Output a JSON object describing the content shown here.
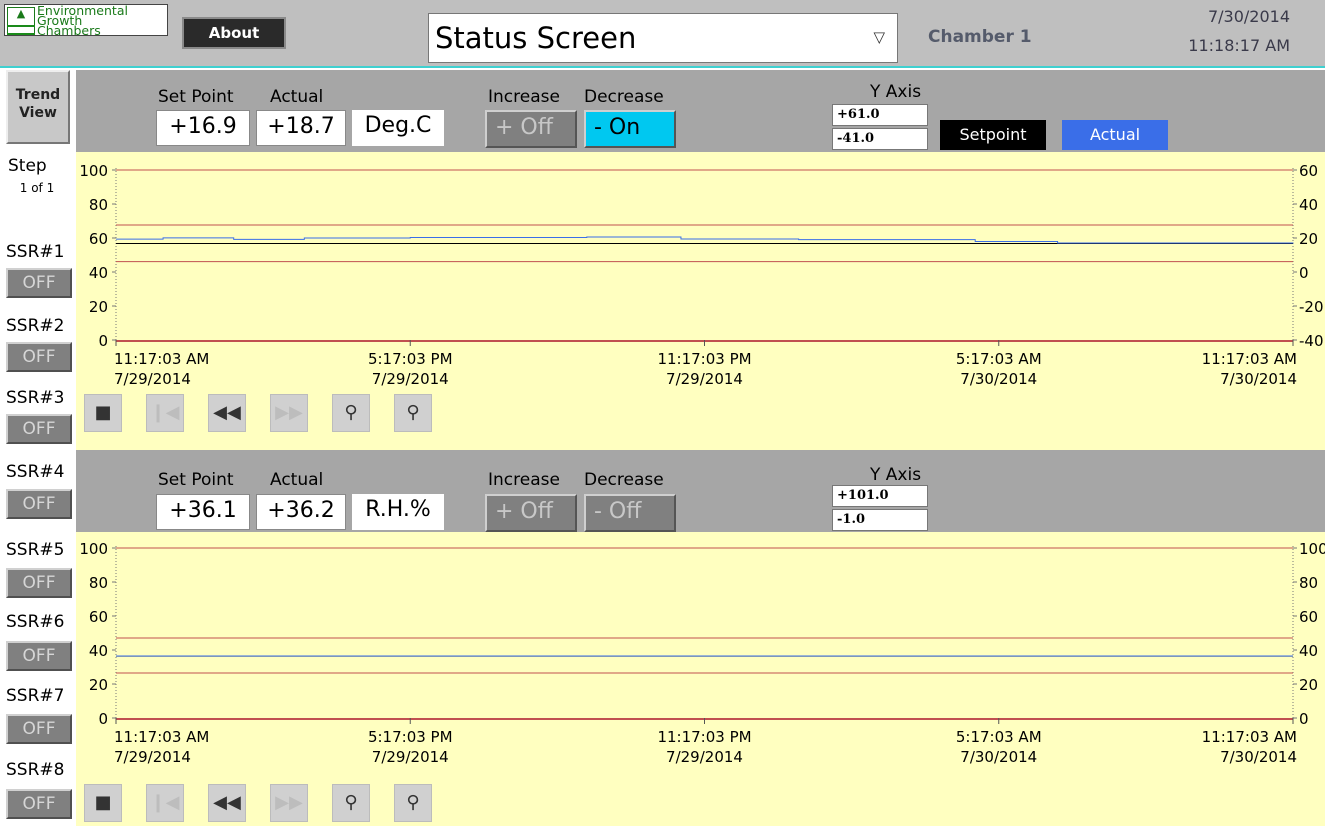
{
  "header": {
    "logo_lines": [
      "Environmental",
      "Growth",
      "Chambers"
    ],
    "about_label": "About",
    "screen_select": "Status Screen",
    "chamber": "Chamber 1",
    "date": "7/30/2014",
    "time": "11:18:17 AM"
  },
  "sidebar": {
    "trend_view_label": "Trend View",
    "step_label": "Step",
    "step_value": "1 of 1",
    "ssr": [
      {
        "label": "SSR#1",
        "state": "OFF"
      },
      {
        "label": "SSR#2",
        "state": "OFF"
      },
      {
        "label": "SSR#3",
        "state": "OFF"
      },
      {
        "label": "SSR#4",
        "state": "OFF"
      },
      {
        "label": "SSR#5",
        "state": "OFF"
      },
      {
        "label": "SSR#6",
        "state": "OFF"
      },
      {
        "label": "SSR#7",
        "state": "OFF"
      },
      {
        "label": "SSR#8",
        "state": "OFF"
      }
    ]
  },
  "temp_panel": {
    "setpoint_label": "Set Point",
    "actual_label": "Actual",
    "setpoint": "+16.9",
    "actual": "+18.7",
    "unit": "Deg.C",
    "increase_label": "Increase",
    "decrease_label": "Decrease",
    "increase_state": "+ Off",
    "decrease_state": "- On",
    "yaxis_label": "Y Axis",
    "yaxis_max": "+61.0",
    "yaxis_min": "-41.0",
    "legend_setpoint": "Setpoint",
    "legend_actual": "Actual"
  },
  "rh_panel": {
    "setpoint_label": "Set Point",
    "actual_label": "Actual",
    "setpoint": "+36.1",
    "actual": "+36.2",
    "unit": "R.H.%",
    "increase_label": "Increase",
    "decrease_label": "Decrease",
    "increase_state": "+ Off",
    "decrease_state": "- Off",
    "yaxis_label": "Y Axis",
    "yaxis_max": "+101.0",
    "yaxis_min": "-1.0"
  },
  "colors": {
    "active_button": "#00c8f0",
    "inactive_button": "#808080",
    "setpoint_series": "#000000",
    "actual_series": "#3a6ee8",
    "limit_lines": "#c05050",
    "chart_bg": "#ffffc0"
  },
  "nav_icons": [
    "stop-icon",
    "skip-start-icon",
    "rewind-icon",
    "fast-forward-icon",
    "zoom-in-icon",
    "zoom-out-icon"
  ],
  "chart_data": [
    {
      "type": "line",
      "left_ticks": [
        "100",
        "80",
        "60",
        "40",
        "20",
        "0"
      ],
      "right_ticks": [
        "60",
        "40",
        "20",
        "0",
        "-20",
        "-40"
      ],
      "ylim_left": [
        0,
        100
      ],
      "ylim_right": [
        -41,
        61
      ],
      "x_labels": [
        {
          "time": "11:17:03 AM",
          "date": "7/29/2014"
        },
        {
          "time": "5:17:03 PM",
          "date": "7/29/2014"
        },
        {
          "time": "11:17:03 PM",
          "date": "7/29/2014"
        },
        {
          "time": "5:17:03 AM",
          "date": "7/30/2014"
        },
        {
          "time": "11:17:03 AM",
          "date": "7/30/2014"
        }
      ],
      "limit_lines_right_units": [
        28.0,
        6.0
      ],
      "series": [
        {
          "values": [
            16.9,
            16.9,
            16.9,
            16.9,
            16.9
          ]
        },
        {
          "x": [
            0,
            0.04,
            0.1,
            0.16,
            0.25,
            0.4,
            0.48,
            0.58,
            0.73,
            0.8,
            1.0
          ],
          "values": [
            19.5,
            20.3,
            19.4,
            20.2,
            20.5,
            20.8,
            19.6,
            19.2,
            18.1,
            17.2,
            17.0
          ]
        }
      ]
    },
    {
      "type": "line",
      "left_ticks": [
        "100",
        "80",
        "60",
        "40",
        "20",
        "0"
      ],
      "right_ticks": [
        "100",
        "80",
        "60",
        "40",
        "20",
        "0"
      ],
      "ylim_left": [
        0,
        100
      ],
      "ylim_right": [
        -1,
        101
      ],
      "x_labels": [
        {
          "time": "11:17:03 AM",
          "date": "7/29/2014"
        },
        {
          "time": "5:17:03 PM",
          "date": "7/29/2014"
        },
        {
          "time": "11:17:03 PM",
          "date": "7/29/2014"
        },
        {
          "time": "5:17:03 AM",
          "date": "7/30/2014"
        },
        {
          "time": "11:17:03 AM",
          "date": "7/30/2014"
        }
      ],
      "limit_lines_right_units": [
        47.0,
        26.0
      ],
      "series": [
        {
          "values": [
            36.1,
            36.1,
            36.1,
            36.1,
            36.1
          ]
        },
        {
          "values": [
            36.2,
            36.2,
            36.2,
            36.2,
            36.2
          ]
        }
      ]
    }
  ]
}
